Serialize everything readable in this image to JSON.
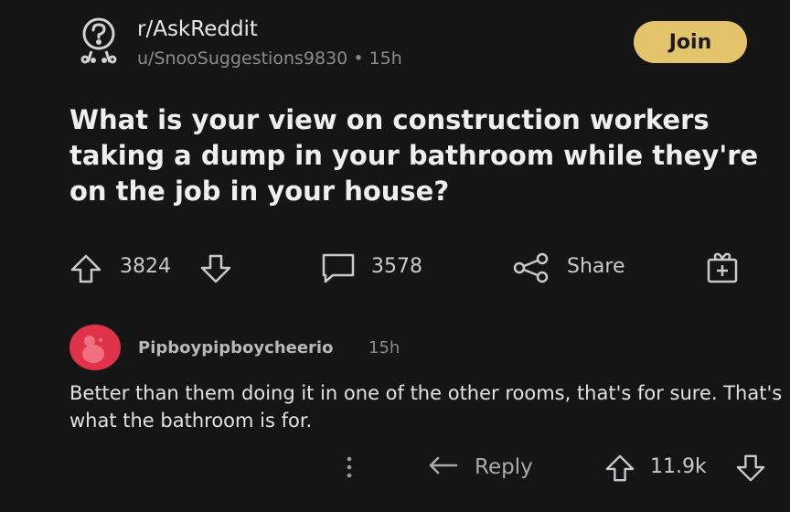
{
  "header": {
    "subreddit": "r/AskReddit",
    "author": "u/SnooSuggestions9830",
    "separator": "•",
    "age": "15h",
    "join_label": "Join"
  },
  "post": {
    "title": "What is your view on construction workers taking a dump in your bathroom while they're on the job in your house?",
    "votes": "3824",
    "comments": "3578",
    "share_label": "Share"
  },
  "comment": {
    "author": "Pipboypipboycheerio",
    "age": "15h",
    "body": "Better than them doing it in one of the other rooms, that's for sure. That's what the bathroom is for.",
    "reply_label": "Reply",
    "score": "11.9k"
  },
  "colors": {
    "background": "#151515",
    "join_button": "#e4c46a",
    "avatar": "#e0334a"
  },
  "icons": [
    "askreddit-snoo-icon",
    "upvote-icon",
    "downvote-icon",
    "comment-icon",
    "share-icon",
    "award-icon",
    "avatar-snoo-icon",
    "more-options-icon",
    "reply-icon"
  ]
}
